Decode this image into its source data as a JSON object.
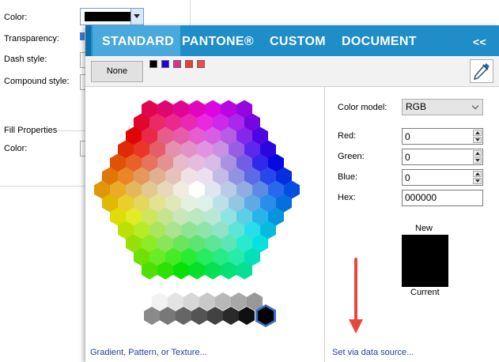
{
  "properties_panel": {
    "color_label": "Color:",
    "transparency_label": "Transparency:",
    "dash_style_label": "Dash style:",
    "compound_style_label": "Compound style:",
    "fill_section_title": "Fill Properties",
    "fill_color_label": "Color:",
    "line_color": "#000000"
  },
  "tabs": [
    {
      "label": "STANDARD",
      "selected": true
    },
    {
      "label": "PANTONE®",
      "selected": false
    },
    {
      "label": "CUSTOM",
      "selected": false
    },
    {
      "label": "DOCUMENT",
      "selected": false
    }
  ],
  "collapse_label": "<<",
  "none_button": "None",
  "recent_colors": [
    "#000000",
    "#1e00f0",
    "#e0308a",
    "#f03c2c",
    "#f04a4a"
  ],
  "eyedropper_icon": "eyedropper-icon",
  "color_model": {
    "label": "Color model:",
    "value": "RGB"
  },
  "red": {
    "label": "Red:",
    "value": "0"
  },
  "green": {
    "label": "Green:",
    "value": "0"
  },
  "blue": {
    "label": "Blue:",
    "value": "0"
  },
  "hex": {
    "label": "Hex:",
    "value": "000000"
  },
  "preview": {
    "new_label": "New",
    "current_label": "Current",
    "color": "#000000"
  },
  "links": {
    "gradient": "Gradient, Pattern, or Texture...",
    "data_source": "Set via data source..."
  },
  "accent_color": "#1e8dc8",
  "annotation_arrow_color": "#e8473f"
}
